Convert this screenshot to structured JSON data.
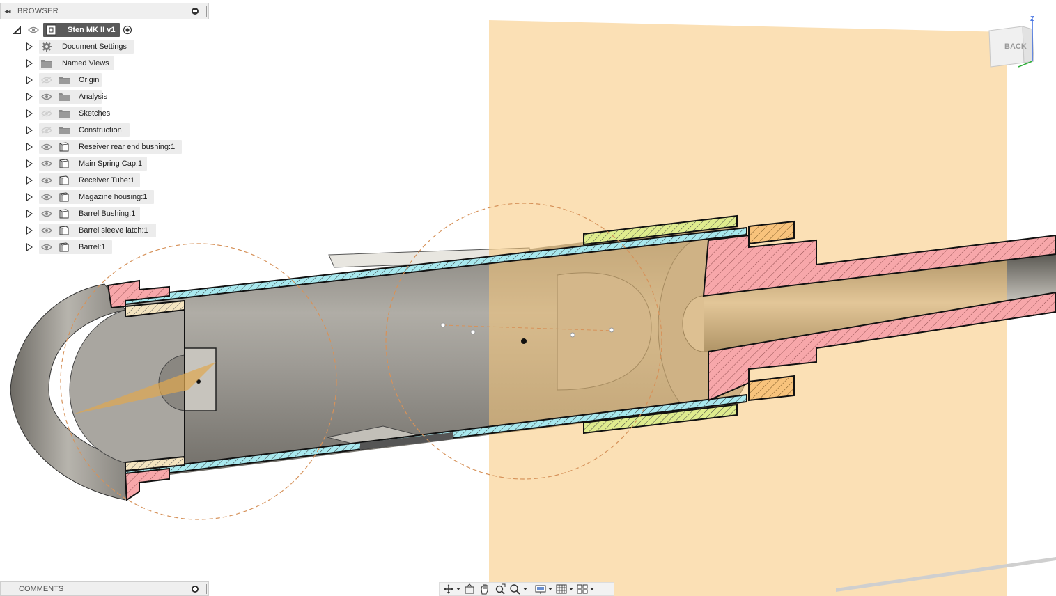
{
  "browser": {
    "title": "BROWSER",
    "root": {
      "label": "Sten MK II v1"
    },
    "items": [
      {
        "label": "Document Settings",
        "icon": "gear-icon",
        "visibility": "none"
      },
      {
        "label": "Named Views",
        "icon": "folder-icon",
        "visibility": "none"
      },
      {
        "label": "Origin",
        "icon": "folder-icon",
        "visibility": "hidden"
      },
      {
        "label": "Analysis",
        "icon": "folder-icon",
        "visibility": "visible"
      },
      {
        "label": "Sketches",
        "icon": "folder-icon",
        "visibility": "hidden"
      },
      {
        "label": "Construction",
        "icon": "folder-icon",
        "visibility": "hidden"
      },
      {
        "label": "Reseiver rear end bushing:1",
        "icon": "component-icon",
        "visibility": "visible"
      },
      {
        "label": "Main Spring Cap:1",
        "icon": "component-icon",
        "visibility": "visible"
      },
      {
        "label": "Receiver Tube:1",
        "icon": "component-icon",
        "visibility": "visible"
      },
      {
        "label": "Magazine housing:1",
        "icon": "component-icon",
        "visibility": "visible"
      },
      {
        "label": "Barrel Bushing:1",
        "icon": "component-icon",
        "visibility": "visible"
      },
      {
        "label": "Barrel sleeve latch:1",
        "icon": "component-icon",
        "visibility": "visible"
      },
      {
        "label": "Barrel:1",
        "icon": "component-icon",
        "visibility": "visible"
      }
    ]
  },
  "comments": {
    "title": "COMMENTS"
  },
  "viewcube": {
    "face": "BACK",
    "axis": "Z"
  },
  "toolbar": {
    "tools": [
      "orbit-icon",
      "look-at-icon",
      "pan-icon",
      "zoom-fit-icon",
      "zoom-icon",
      "display-settings-icon",
      "grid-icon",
      "viewports-icon"
    ]
  },
  "colors": {
    "plane": "#f8c778",
    "hatch_blue": "#9fe3ea",
    "hatch_pink": "#f7a6a8",
    "hatch_yellow": "#dce88a",
    "hatch_orange": "#f5c07a",
    "body_gray": "#8f8c86",
    "sketch_orange": "#d6925a"
  }
}
